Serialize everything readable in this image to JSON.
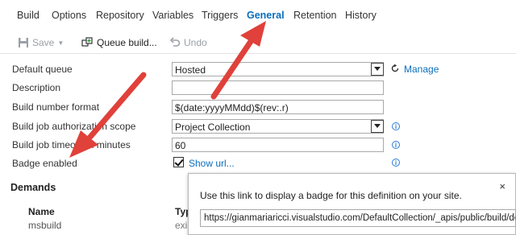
{
  "tabs": [
    "Build",
    "Options",
    "Repository",
    "Variables",
    "Triggers",
    "General",
    "Retention",
    "History"
  ],
  "active_tab": "General",
  "toolbar": {
    "save_label": "Save",
    "queue_label": "Queue build...",
    "undo_label": "Undo"
  },
  "form": {
    "default_queue": {
      "label": "Default queue",
      "value": "Hosted",
      "manage_label": "Manage"
    },
    "description": {
      "label": "Description",
      "value": ""
    },
    "build_number_format": {
      "label": "Build number format",
      "value": "$(date:yyyyMMdd)$(rev:.r)"
    },
    "auth_scope": {
      "label": "Build job authorization scope",
      "value": "Project Collection"
    },
    "timeout": {
      "label": "Build job timeout in minutes",
      "value": "60"
    },
    "badge": {
      "label": "Badge enabled",
      "checked": true,
      "show_url_label": "Show url..."
    }
  },
  "demands": {
    "title": "Demands",
    "col_name": "Name",
    "col_type": "Typ",
    "rows": [
      {
        "name": "msbuild",
        "type": "exis"
      }
    ]
  },
  "popup": {
    "text": "Use this link to display a badge for this definition on your site.",
    "url": "https://gianmariaricci.visualstudio.com/DefaultCollection/_apis/public/build/de",
    "close": "×"
  },
  "colors": {
    "accent": "#0a6ebd",
    "arrow": "#e0413a"
  }
}
